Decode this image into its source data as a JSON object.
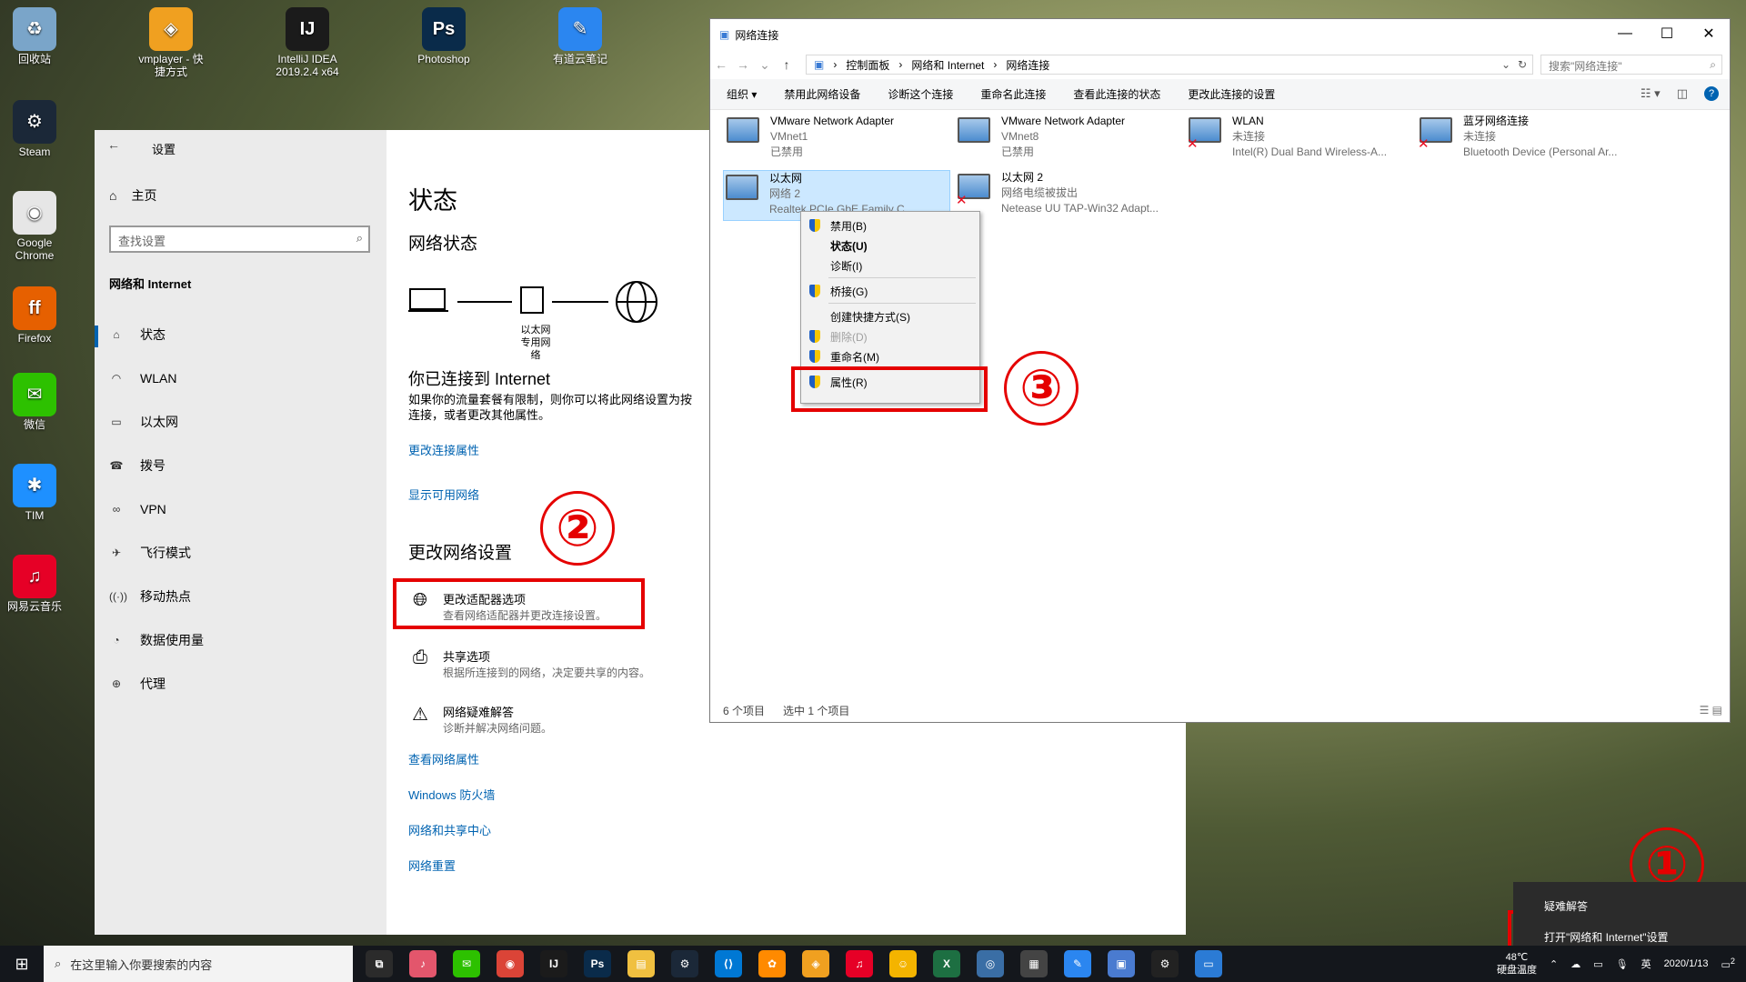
{
  "desktop": {
    "icons": [
      {
        "label": "回收站",
        "color": "#7aa5c9",
        "glyph": "♻"
      },
      {
        "label": "vmplayer - 快捷方式",
        "color": "#f0a020",
        "glyph": "◈"
      },
      {
        "label": "IntelliJ IDEA 2019.2.4 x64",
        "color": "#1b1b1b",
        "glyph": "IJ"
      },
      {
        "label": "Photoshop",
        "color": "#0a2b4a",
        "glyph": "Ps"
      },
      {
        "label": "有道云笔记",
        "color": "#2b86f0",
        "glyph": "✎"
      },
      {
        "label": "Steam",
        "color": "#1b2838",
        "glyph": "⚙"
      },
      {
        "label": "Google Chrome",
        "color": "#e6e6e6",
        "glyph": "◉"
      },
      {
        "label": "Firefox",
        "color": "#e66000",
        "glyph": "ff"
      },
      {
        "label": "微信",
        "color": "#2dc100",
        "glyph": "✉"
      },
      {
        "label": "TIM",
        "color": "#1e90ff",
        "glyph": "✱"
      },
      {
        "label": "网易云音乐",
        "color": "#e60026",
        "glyph": "♫"
      }
    ]
  },
  "settings": {
    "title": "设置",
    "home": "主页",
    "search_placeholder": "查找设置",
    "section": "网络和 Internet",
    "nav": [
      {
        "label": "状态",
        "icon": "home-status-icon",
        "glyph": "⌂"
      },
      {
        "label": "WLAN",
        "icon": "wifi-icon",
        "glyph": "◠"
      },
      {
        "label": "以太网",
        "icon": "ethernet-icon",
        "glyph": "▭"
      },
      {
        "label": "拨号",
        "icon": "dialup-icon",
        "glyph": "☎"
      },
      {
        "label": "VPN",
        "icon": "vpn-icon",
        "glyph": "∞"
      },
      {
        "label": "飞行模式",
        "icon": "airplane-icon",
        "glyph": "✈"
      },
      {
        "label": "移动热点",
        "icon": "hotspot-icon",
        "glyph": "((·))"
      },
      {
        "label": "数据使用量",
        "icon": "data-usage-icon",
        "glyph": "◔"
      },
      {
        "label": "代理",
        "icon": "globe-icon",
        "glyph": "⊕"
      }
    ],
    "main": {
      "title": "状态",
      "network_status": "网络状态",
      "diagram_label1": "以太网",
      "diagram_label2": "专用网络",
      "connected": "你已连接到 Internet",
      "desc": "如果你的流量套餐有限制，则你可以将此网络设置为按",
      "desc2": "连接，或者更改其他属性。",
      "link_change_props": "更改连接属性",
      "link_show_networks": "显示可用网络",
      "change_settings": "更改网络设置",
      "opt_adapter_title": "更改适配器选项",
      "opt_adapter_sub": "查看网络适配器并更改连接设置。",
      "opt_share_title": "共享选项",
      "opt_share_sub": "根据所连接到的网络，决定要共享的内容。",
      "opt_trouble_title": "网络疑难解答",
      "opt_trouble_sub": "诊断并解决网络问题。",
      "link_view_props": "查看网络属性",
      "link_firewall": "Windows 防火墙",
      "link_center": "网络和共享中心",
      "link_reset": "网络重置"
    }
  },
  "netwin": {
    "title": "网络连接",
    "breadcrumb": [
      "控制面板",
      "网络和 Internet",
      "网络连接"
    ],
    "search_placeholder": "搜索\"网络连接\"",
    "commands": [
      "组织 ▾",
      "禁用此网络设备",
      "诊断这个连接",
      "重命名此连接",
      "查看此连接的状态",
      "更改此连接的设置"
    ],
    "adapters": [
      {
        "name": "VMware Network Adapter",
        "line2": "VMnet1",
        "line3": "已禁用",
        "x": false
      },
      {
        "name": "VMware Network Adapter",
        "line2": "VMnet8",
        "line3": "已禁用",
        "x": false
      },
      {
        "name": "WLAN",
        "line2": "未连接",
        "line3": "Intel(R) Dual Band Wireless-A...",
        "x": true
      },
      {
        "name": "蓝牙网络连接",
        "line2": "未连接",
        "line3": "Bluetooth Device (Personal Ar...",
        "x": true
      },
      {
        "name": "以太网",
        "line2": "网络 2",
        "line3": "Realtek PCIe GbE Family C...",
        "x": false
      },
      {
        "name": "以太网 2",
        "line2": "网络电缆被拔出",
        "line3": "Netease UU TAP-Win32 Adapt...",
        "x": true
      }
    ],
    "status_count": "6 个项目",
    "status_selected": "选中 1 个项目"
  },
  "context_menu": {
    "items": [
      "禁用(B)",
      "状态(U)",
      "诊断(I)",
      "桥接(G)",
      "创建快捷方式(S)",
      "删除(D)",
      "重命名(M)",
      "属性(R)"
    ]
  },
  "annotations": {
    "one": "①",
    "two": "②",
    "three": "③"
  },
  "tray_popup": {
    "troubleshoot": "疑难解答",
    "open_settings": "打开\"网络和 Internet\"设置"
  },
  "taskbar": {
    "search_placeholder": "在这里输入你要搜索的内容",
    "temp": "48℃",
    "temp_label": "硬盘温度",
    "ime": "英",
    "date": "2020/1/13",
    "notif_count": "2"
  }
}
